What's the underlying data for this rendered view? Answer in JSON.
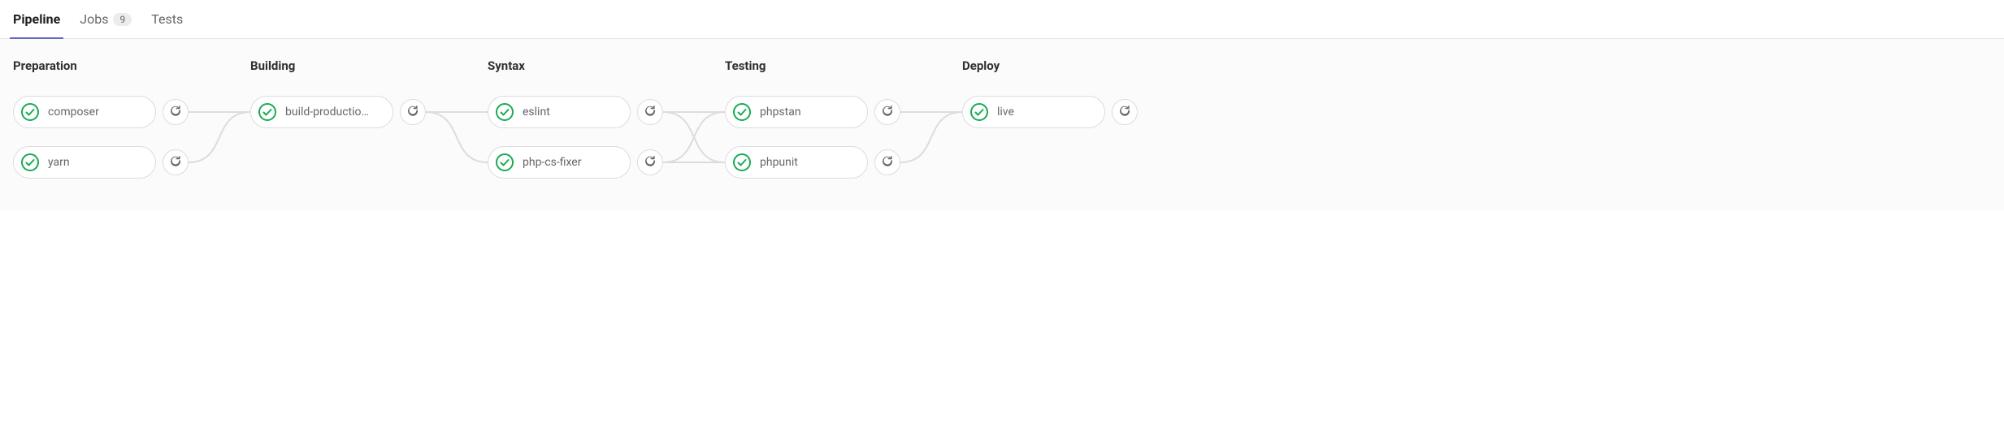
{
  "tabs": {
    "pipeline": "Pipeline",
    "jobs": "Jobs",
    "jobs_count": "9",
    "tests": "Tests"
  },
  "stages": [
    {
      "title": "Preparation",
      "jobs": [
        {
          "name": "composer",
          "status": "success"
        },
        {
          "name": "yarn",
          "status": "success"
        }
      ]
    },
    {
      "title": "Building",
      "jobs": [
        {
          "name": "build-productio…",
          "status": "success"
        }
      ]
    },
    {
      "title": "Syntax",
      "jobs": [
        {
          "name": "eslint",
          "status": "success"
        },
        {
          "name": "php-cs-fixer",
          "status": "success"
        }
      ]
    },
    {
      "title": "Testing",
      "jobs": [
        {
          "name": "phpstan",
          "status": "success"
        },
        {
          "name": "phpunit",
          "status": "success"
        }
      ]
    },
    {
      "title": "Deploy",
      "jobs": [
        {
          "name": "live",
          "status": "success"
        }
      ]
    }
  ],
  "colors": {
    "success": "#1aaa55",
    "connector": "#dcdcde"
  }
}
